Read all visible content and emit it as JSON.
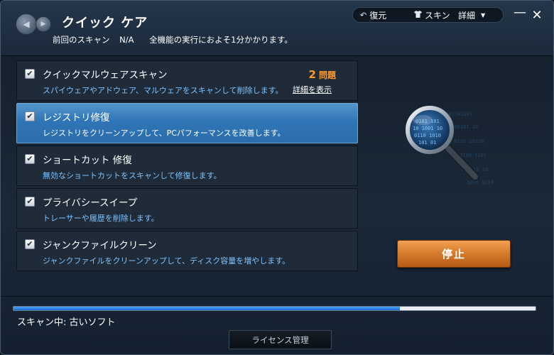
{
  "app": {
    "title": "クイック ケア",
    "last_scan_label": "前回のスキャン",
    "last_scan_value": "N/A",
    "estimate_text": "全機能の実行におよそ1分かかります。"
  },
  "toolbar": {
    "restore_label": "復元",
    "skin_label": "スキン",
    "details_label": "詳細"
  },
  "window_controls": {
    "minimize": "—",
    "close": "✕"
  },
  "icons": {
    "back": "back-arrow-icon",
    "forward": "forward-arrow-icon",
    "restore": "undo-icon",
    "skin": "shirt-icon",
    "check": "checkmark-icon",
    "magnifier": "magnifier-icon"
  },
  "items": [
    {
      "title": "クイックマルウェアスキャン",
      "desc": "スパイウェアやアドウェア、マルウェアをスキャンして削除します。",
      "issues_count": "2",
      "issues_label": "問題",
      "detail_link": "詳細を表示",
      "checked": true,
      "active": false
    },
    {
      "title": "レジストリ修復",
      "desc": "レジストリをクリーンアップして、PCパフォーマンスを改善します。",
      "checked": true,
      "active": true
    },
    {
      "title": "ショートカット 修復",
      "desc": "無効なショートカットをスキャンして修復します。",
      "checked": true,
      "active": false
    },
    {
      "title": "プライバシースイープ",
      "desc": "トレーサーや履歴を削除します。",
      "checked": true,
      "active": false
    },
    {
      "title": "ジャンクファイルクリーン",
      "desc": "ジャンクファイルをクリーンアップして、ディスク容量を増やします。",
      "checked": true,
      "active": false
    }
  ],
  "stop_button": "停止",
  "progress": {
    "fraction": 0.74
  },
  "status_text": "スキャン中: 古いソフト",
  "license_button": "ライセンス管理",
  "colors": {
    "accent_orange": "#d6792a",
    "active_blue": "#2f74b4",
    "issue_orange": "#ff9a2a",
    "desc_blue": "#7fc3ff"
  }
}
